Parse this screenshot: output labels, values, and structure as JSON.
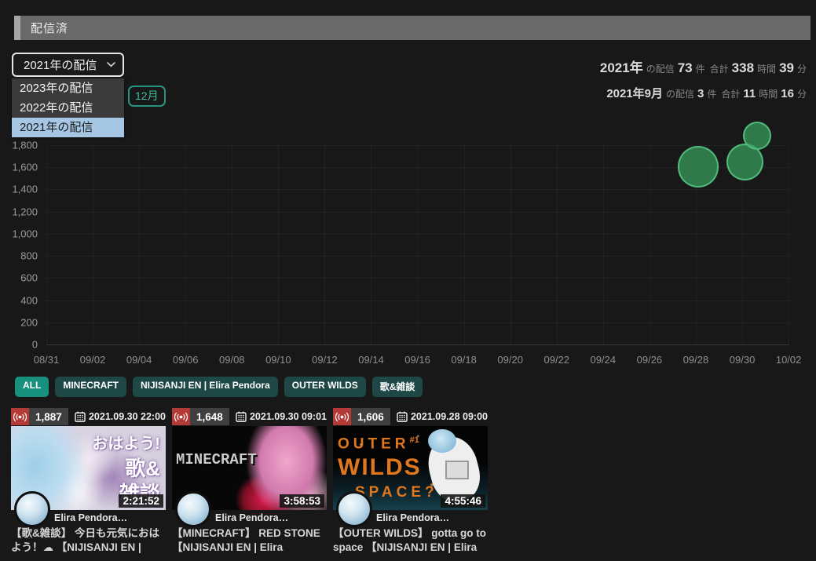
{
  "header": {
    "title": "配信済"
  },
  "year_select": {
    "value": "2021年の配信",
    "options": [
      "2023年の配信",
      "2022年の配信",
      "2021年の配信"
    ],
    "selected_index": 2
  },
  "month_badge": "12月",
  "stats_lines": [
    {
      "name": "year-stats",
      "parts": [
        [
          "2021年",
          "b"
        ],
        [
          "の配信",
          "s"
        ],
        [
          "73",
          "b"
        ],
        [
          "件",
          "s"
        ],
        [
          "合計",
          "s"
        ],
        [
          "338",
          "b"
        ],
        [
          "時間",
          "s"
        ],
        [
          "39",
          "b"
        ],
        [
          "分",
          "s"
        ]
      ]
    },
    {
      "name": "month-stats",
      "parts": [
        [
          "2021年9月",
          "b"
        ],
        [
          "の配信",
          "s"
        ],
        [
          "3",
          "b"
        ],
        [
          "件",
          "s"
        ],
        [
          "合計",
          "s"
        ],
        [
          "11",
          "b"
        ],
        [
          "時間",
          "s"
        ],
        [
          "16",
          "b"
        ],
        [
          "分",
          "s"
        ]
      ]
    }
  ],
  "chart_data": {
    "type": "scatter",
    "subtype": "bubble",
    "x_ticks": [
      "08/31",
      "09/02",
      "09/04",
      "09/06",
      "09/08",
      "09/10",
      "09/12",
      "09/14",
      "09/16",
      "09/18",
      "09/20",
      "09/22",
      "09/24",
      "09/26",
      "09/28",
      "09/30",
      "10/02"
    ],
    "y_ticks": [
      0,
      200,
      400,
      600,
      800,
      1000,
      1200,
      1400,
      1600,
      1800
    ],
    "ylim": [
      0,
      1850
    ],
    "grid": true,
    "x_axis": "date",
    "y_axis": "viewers",
    "bubble_size": "duration",
    "points": [
      {
        "datetime": "2021.09.28 09:00",
        "viewers": 1606,
        "duration": "4:55:46",
        "label": "OUTER WILDS"
      },
      {
        "datetime": "2021.09.30 09:01",
        "viewers": 1648,
        "duration": "3:58:53",
        "label": "MINECRAFT"
      },
      {
        "datetime": "2021.09.30 22:00",
        "viewers": 1887,
        "duration": "2:21:52",
        "label": "歌&雑談"
      }
    ],
    "bubble_fill": "#3aa05e",
    "bubble_stroke": "#52c07d"
  },
  "filters": [
    {
      "label": "ALL",
      "active": true
    },
    {
      "label": "MINECRAFT",
      "active": false
    },
    {
      "label": "NIJISANJI EN | Elira Pendora",
      "active": false
    },
    {
      "label": "OUTER WILDS",
      "active": false
    },
    {
      "label": "歌&雑談",
      "active": false
    }
  ],
  "videos": [
    {
      "viewers": "1,887",
      "datetime": "2021.09.30 22:00",
      "duration": "2:21:52",
      "channel": "Elira Pendora…",
      "title": "【歌&雑談】 今日も元気におはよう！☁ 【NIJISANJI EN | Elira Pen...",
      "thumb": "uta",
      "thumb_lines": [
        "おはよう!",
        "歌&",
        "雑談"
      ]
    },
    {
      "viewers": "1,648",
      "datetime": "2021.09.30 09:01",
      "duration": "3:58:53",
      "channel": "Elira Pendora…",
      "title": "【MINECRAFT】 RED STONE 【NIJISANJI EN | Elira Pendora】",
      "thumb": "minecraft",
      "thumb_lines": [
        "MINECRAFT"
      ]
    },
    {
      "viewers": "1,606",
      "datetime": "2021.09.28 09:00",
      "duration": "4:55:46",
      "channel": "Elira Pendora…",
      "title": "【OUTER WILDS】 gotta go to space 【NIJISANJI EN | Elira Pendora】",
      "thumb": "outerwilds",
      "thumb_lines": [
        "OUTER",
        "#1",
        "WILDS",
        "SPACE?"
      ]
    }
  ],
  "colors": {
    "background": "#181818",
    "header_bar": "#696969",
    "accent_teal": "#17907e",
    "tag_dark": "#1d4845",
    "live_red": "#b43a38",
    "select_highlight": "#a5c7e3",
    "month_badge_teal": "#41bda1"
  }
}
